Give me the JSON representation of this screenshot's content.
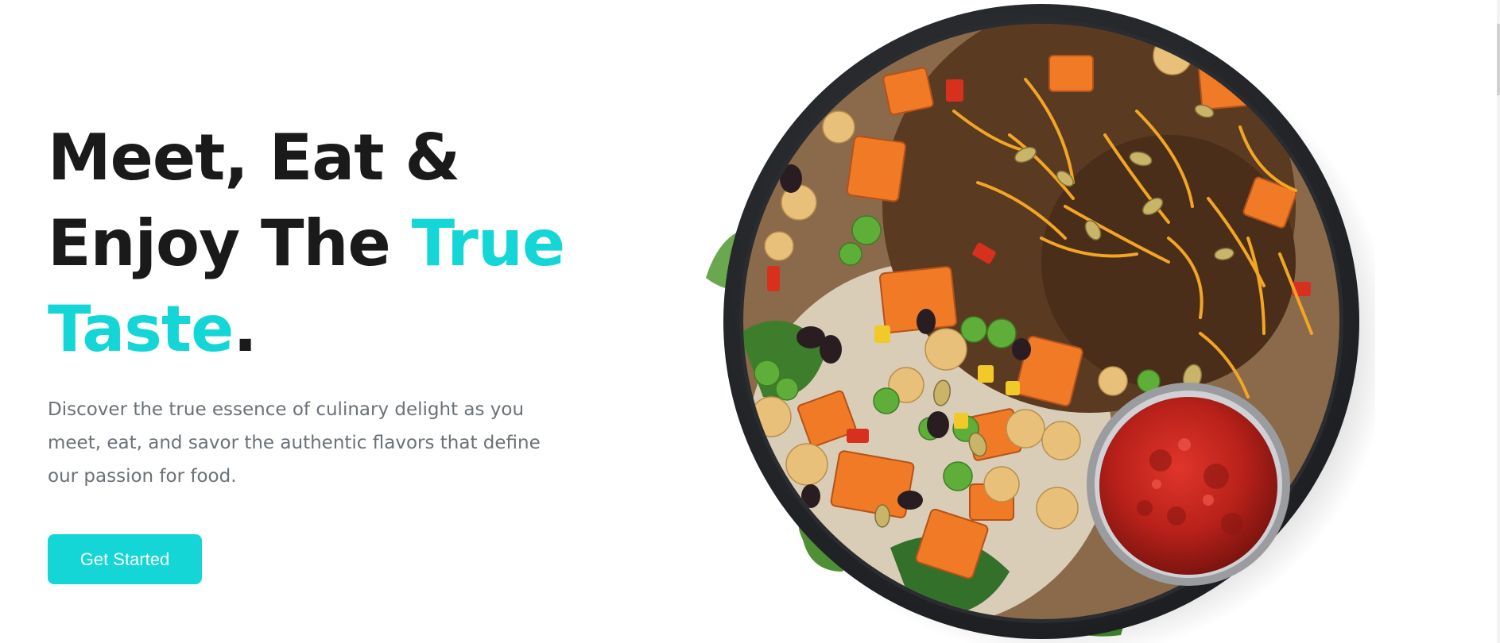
{
  "hero": {
    "title_line1": "Meet, Eat &",
    "title_line2_plain": "Enjoy The ",
    "title_line2_accent": "True",
    "title_line3_accent": "Taste",
    "title_line3_end": ".",
    "description": "Discover the true essence of culinary delight as you meet, eat, and savor the authentic flavors that define our passion for food.",
    "cta_label": "Get Started"
  },
  "colors": {
    "accent": "#14d6d6",
    "title": "#1a1a1a",
    "body_text": "#6b7178",
    "button_text": "#ffffff"
  },
  "image": {
    "subject": "food-bowl"
  }
}
